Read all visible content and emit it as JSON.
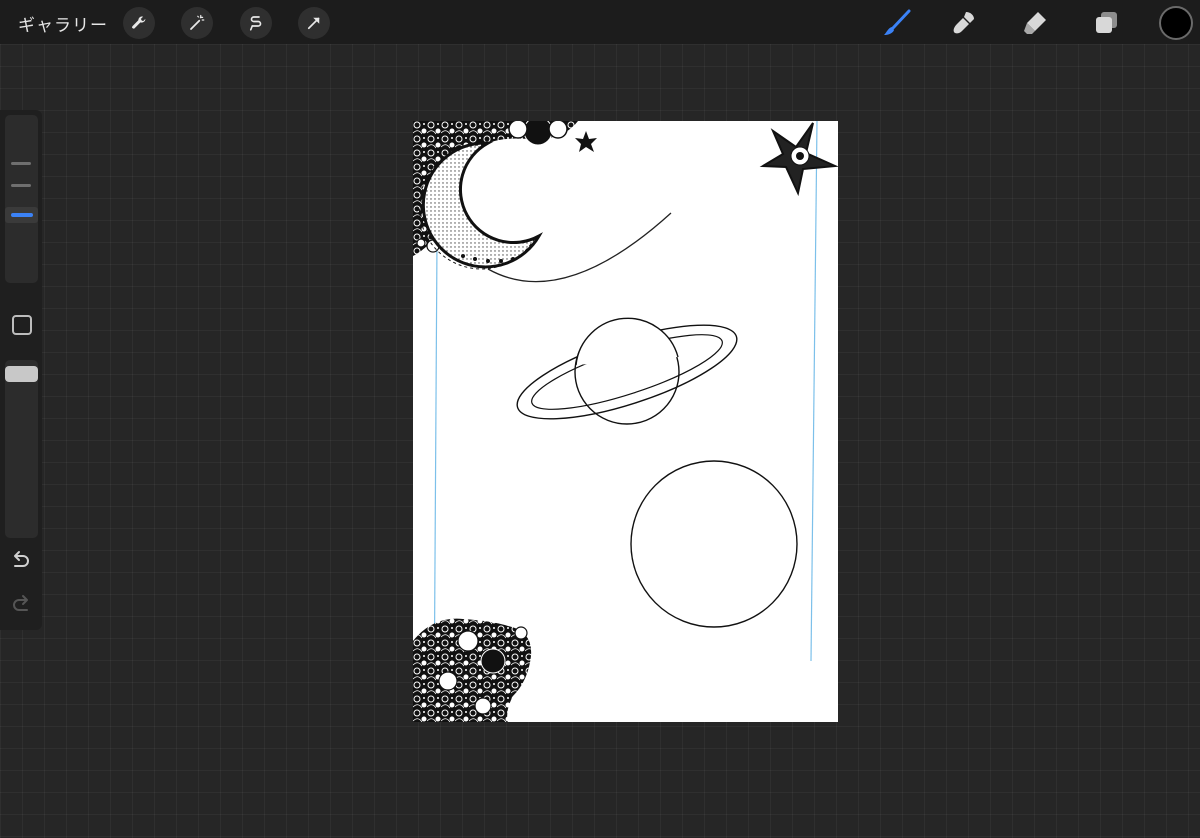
{
  "topbar": {
    "gallery_label": "ギャラリー",
    "left_tools": [
      {
        "icon": "wrench-icon",
        "name": "actions"
      },
      {
        "icon": "magic-wand-icon",
        "name": "adjustments"
      },
      {
        "icon": "selection-icon",
        "name": "selection"
      },
      {
        "icon": "arrow-cursor-icon",
        "name": "transform"
      }
    ],
    "right_tools": [
      {
        "icon": "brush-icon",
        "name": "paint",
        "active": true
      },
      {
        "icon": "smudge-icon",
        "name": "smudge",
        "active": false
      },
      {
        "icon": "eraser-icon",
        "name": "eraser",
        "active": false
      },
      {
        "icon": "layers-icon",
        "name": "layers",
        "active": false
      }
    ],
    "current_color": "#000000"
  },
  "sidebar": {
    "size_slider_level": 0.55,
    "opacity_slider_level": 1.0,
    "accent_color": "#3b82f6"
  },
  "canvas": {
    "background": "#ffffff",
    "guide_color": "#6fb6e6"
  }
}
